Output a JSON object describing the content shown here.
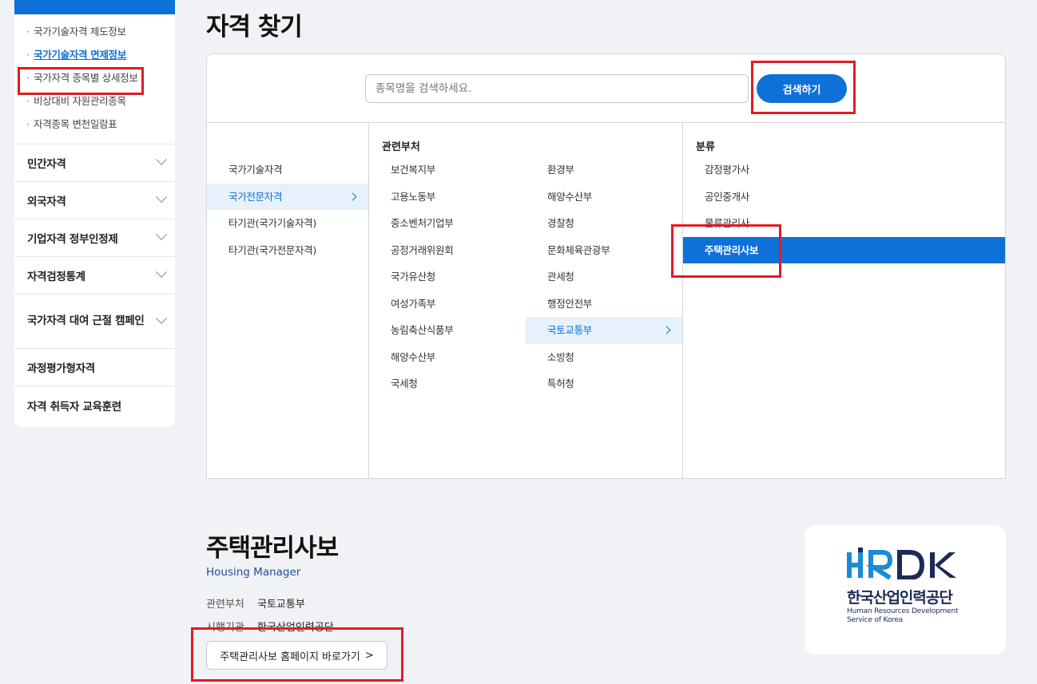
{
  "sidebar": {
    "sub_items": [
      {
        "label": "국가기술자격 제도정보"
      },
      {
        "label": "국가기술자격 면제정보"
      },
      {
        "label": "국가자격 종목별 상세정보"
      },
      {
        "label": "비상대비 자원관리종목"
      },
      {
        "label": "자격종목 변천일람표"
      }
    ],
    "menu": [
      {
        "label": "민간자격"
      },
      {
        "label": "외국자격"
      },
      {
        "label": "기업자격 정부인정제"
      },
      {
        "label": "자격검정통계"
      },
      {
        "label": "국가자격 대여 근절 캠페인"
      },
      {
        "label": "과정평가형자격"
      },
      {
        "label": "자격 취득자 교육훈련"
      }
    ]
  },
  "page_title": "자격 찾기",
  "search": {
    "placeholder": "종목명을 검색하세요.",
    "button_label": "검색하기"
  },
  "categories": {
    "items": [
      "국가기술자격",
      "국가전문자격",
      "타기관(국가기술자격)",
      "타기관(국가전문자격)"
    ],
    "selected": "국가전문자격"
  },
  "departments": {
    "heading": "관련부처",
    "items": [
      "보건복지부",
      "환경부",
      "고용노동부",
      "해양수산부",
      "중소벤처기업부",
      "경찰청",
      "공정거래위원회",
      "문화체육관광부",
      "국가유산청",
      "관세청",
      "여성가족부",
      "행정안전부",
      "농림축산식품부",
      "국토교통부",
      "해양수산부",
      "소방청",
      "국세청",
      "특허청"
    ],
    "selected": "국토교통부"
  },
  "classification": {
    "heading": "분류",
    "items": [
      "감정평가사",
      "공인중개사",
      "물류관리사",
      "주택관리사보"
    ],
    "selected": "주택관리사보"
  },
  "detail": {
    "title": "주택관리사보",
    "subtitle": "Housing Manager",
    "dept_label": "관련부처",
    "dept_value": "국토교통부",
    "org_label": "시행기관",
    "org_value": "한국산업인력공단",
    "home_button": "주택관리사보 홈페이지 바로가기"
  },
  "logo": {
    "mark": "HRDK",
    "name_ko": "한국산업인력공단",
    "name_en": "Human Resources Development Service of Korea"
  },
  "colors": {
    "accent": "#0d71d8",
    "highlight": "#e21b23"
  }
}
